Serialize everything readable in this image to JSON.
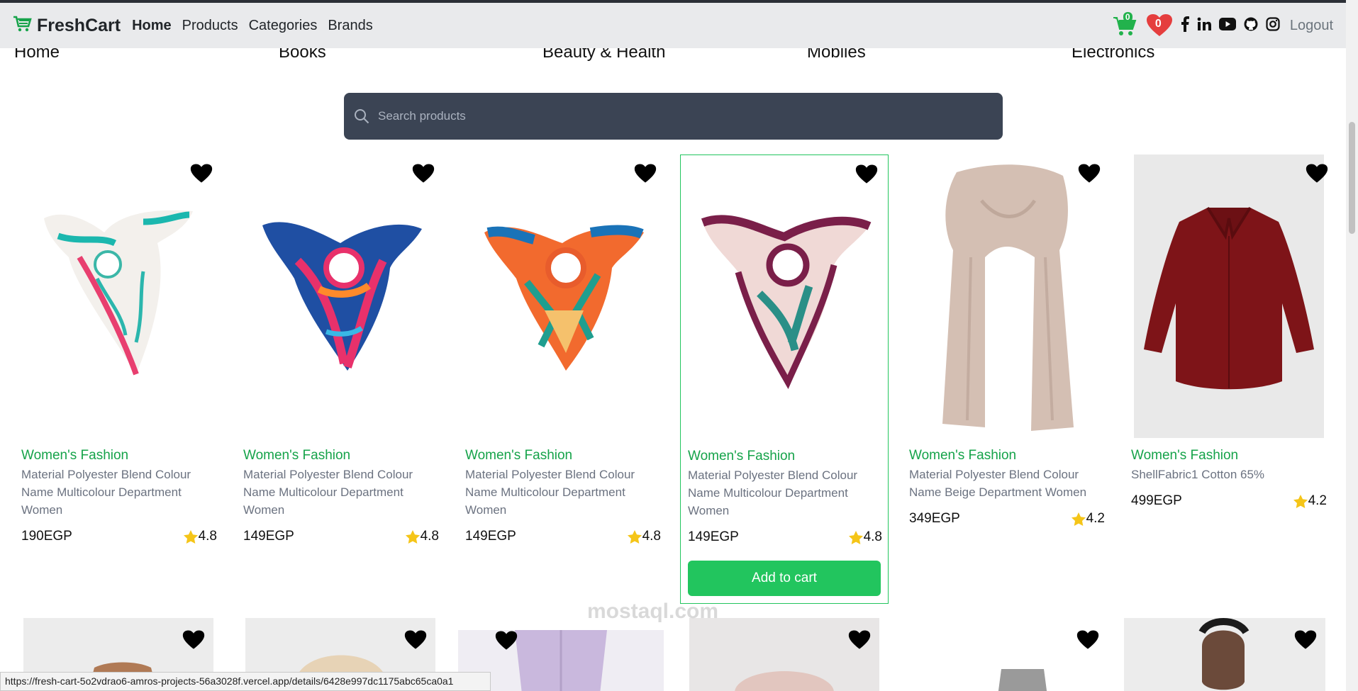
{
  "navbar": {
    "brand": "FreshCart",
    "links": [
      {
        "label": "Home",
        "active": true
      },
      {
        "label": "Products",
        "active": false
      },
      {
        "label": "Categories",
        "active": false
      },
      {
        "label": "Brands",
        "active": false
      }
    ],
    "cart_count": "0",
    "wishlist_count": "0",
    "logout_label": "Logout"
  },
  "categories": [
    "Home",
    "Books",
    "Beauty & Health",
    "Mobiles",
    "Electronics"
  ],
  "search": {
    "placeholder": "Search products"
  },
  "products": [
    {
      "category": "Women's Fashion",
      "title": "Material Polyester Blend Colour Name Multicolour Department Women",
      "price": "190EGP",
      "rating": "4.8"
    },
    {
      "category": "Women's Fashion",
      "title": "Material Polyester Blend Colour Name Multicolour Department Women",
      "price": "149EGP",
      "rating": "4.8"
    },
    {
      "category": "Women's Fashion",
      "title": "Material Polyester Blend Colour Name Multicolour Department Women",
      "price": "149EGP",
      "rating": "4.8"
    },
    {
      "category": "Women's Fashion",
      "title": "Material Polyester Blend Colour Name Multicolour Department Women",
      "price": "149EGP",
      "rating": "4.8",
      "add_to_cart": "Add to cart"
    },
    {
      "category": "Women's Fashion",
      "title": "Material Polyester Blend Colour Name Beige Department Women",
      "price": "349EGP",
      "rating": "4.2"
    },
    {
      "category": "Women's Fashion",
      "title": "ShellFabric1 Cotton 65%",
      "price": "499EGP",
      "rating": "4.2"
    }
  ],
  "status_bar_url": "https://fresh-cart-5o2vdrao6-amros-projects-56a3028f.vercel.app/details/6428e997dc1175abc65ca0a1",
  "watermark": "mostaql.com",
  "colors": {
    "accent": "#22c55e",
    "category_text": "#16a34a",
    "search_bg": "#3b4454",
    "heart_red": "#e53e3e"
  }
}
